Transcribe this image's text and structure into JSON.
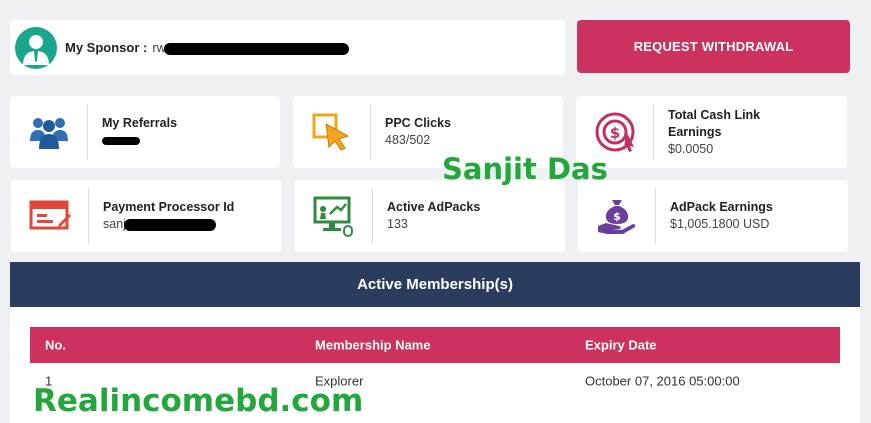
{
  "sponsor": {
    "label": "My Sponsor :",
    "value_prefix": "rw"
  },
  "withdraw_button": "REQUEST WITHDRAWAL",
  "stats": {
    "referrals": {
      "label": "My Referrals",
      "icon": "users-icon"
    },
    "ppc": {
      "label": "PPC Clicks",
      "value": "483/502",
      "icon": "cursor-click-icon"
    },
    "cash_link": {
      "label_line1": "Total Cash Link",
      "label_line2": "Earnings",
      "value": "$0.0050",
      "icon": "cash-link-icon"
    },
    "processor": {
      "label": "Payment Processor Id",
      "value_prefix": "sanj",
      "icon": "payment-form-icon"
    },
    "adpacks": {
      "label": "Active AdPacks",
      "value": "133",
      "icon": "ad-monitor-icon"
    },
    "adpack_earnings": {
      "label": "AdPack Earnings",
      "value": "$1,005.1800 USD",
      "icon": "money-bag-hand-icon"
    }
  },
  "membership": {
    "title": "Active Membership(s)",
    "columns": [
      "No.",
      "Membership Name",
      "Expiry Date"
    ],
    "rows": [
      {
        "no": "1",
        "name": "Explorer",
        "expiry": "October 07, 2016 05:00:00"
      }
    ]
  },
  "watermarks": {
    "name": "Sanjit Das",
    "site": "Realincomebd.com"
  },
  "colors": {
    "accent": "#cc3160",
    "navy": "#2a3d5e",
    "icon_blue": "#2f6fb6",
    "icon_orange": "#f5a31a",
    "icon_pink": "#c2305f",
    "icon_red": "#e0483a",
    "icon_green": "#2e8b3c",
    "icon_purple": "#6a3f9b",
    "watermark": "#22a83a"
  }
}
